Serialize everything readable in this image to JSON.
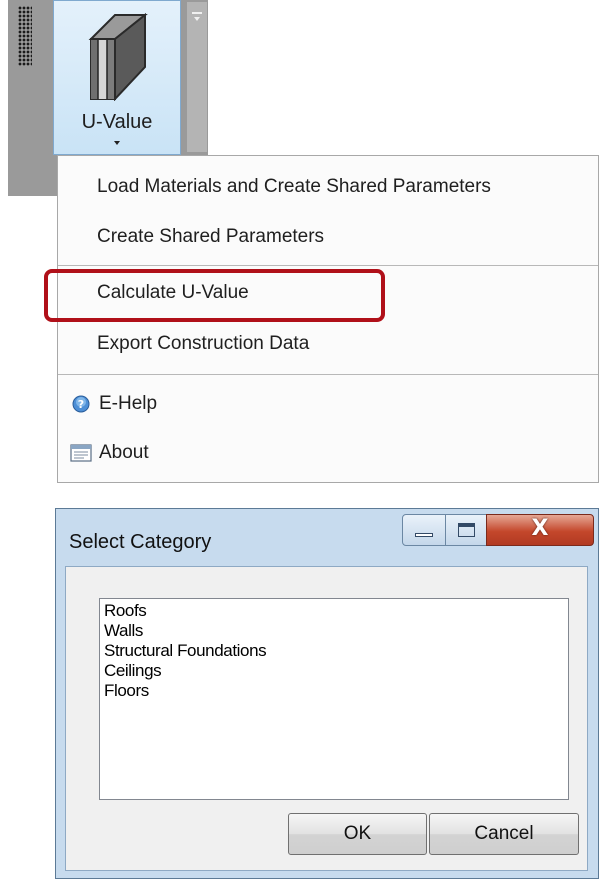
{
  "ribbon": {
    "button_label": "U-Value"
  },
  "menu": {
    "items": [
      {
        "label": "Load Materials and Create Shared Parameters"
      },
      {
        "label": "Create Shared Parameters"
      },
      {
        "label": "Calculate U-Value",
        "highlighted": true
      },
      {
        "label": "Export Construction Data"
      },
      {
        "label": "E-Help",
        "icon": "help-icon"
      },
      {
        "label": "About",
        "icon": "about-icon"
      }
    ],
    "highlight_color": "#b01019"
  },
  "dialog": {
    "title": "Select Category",
    "list_items": [
      "Roofs",
      "Walls",
      "Structural Foundations",
      "Ceilings",
      "Floors"
    ],
    "ok_label": "OK",
    "cancel_label": "Cancel",
    "close_glyph": "X"
  }
}
